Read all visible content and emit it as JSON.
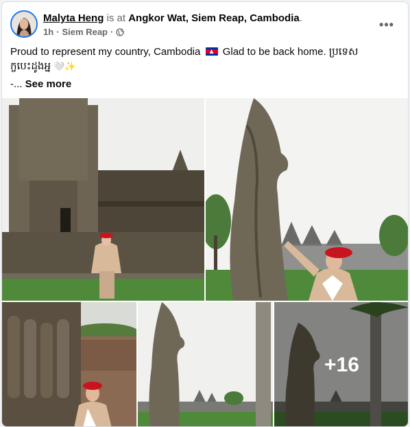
{
  "post": {
    "author": "Malyta Heng",
    "is_at_text": "is at",
    "location": "Angkor Wat, Siem Reap, Cambodia",
    "period": ".",
    "time": "1h",
    "separator": "·",
    "place": "Siem Reap",
    "separator2": "·",
    "menu_icon": "more-horizontal-icon",
    "privacy_icon": "globe-icon",
    "text_part1": "Proud to represent my country, Cambodia",
    "text_part2": "Glad to be back home. ប្រទេស",
    "text_line2": "ក្ចបេះដូងអ្ន",
    "emoji_text": "🤍✨",
    "see_more_prefix": "-...",
    "see_more_label": "See more"
  },
  "gallery": {
    "remaining_count_label": "+16",
    "photos": [
      "photo-angkor-wat-temple",
      "photo-naga-statue",
      "photo-bas-relief-wall",
      "photo-naga-causeway",
      "photo-naga-causeway-more"
    ]
  },
  "colors": {
    "accent": "#1b74e4",
    "secondary_text": "#65676b",
    "sky": "#f3f3f1",
    "grass": "#4f8a3b",
    "stone": "#6e6454",
    "uniform_hat": "#c8141e",
    "uniform_beige": "#d8b99a"
  }
}
